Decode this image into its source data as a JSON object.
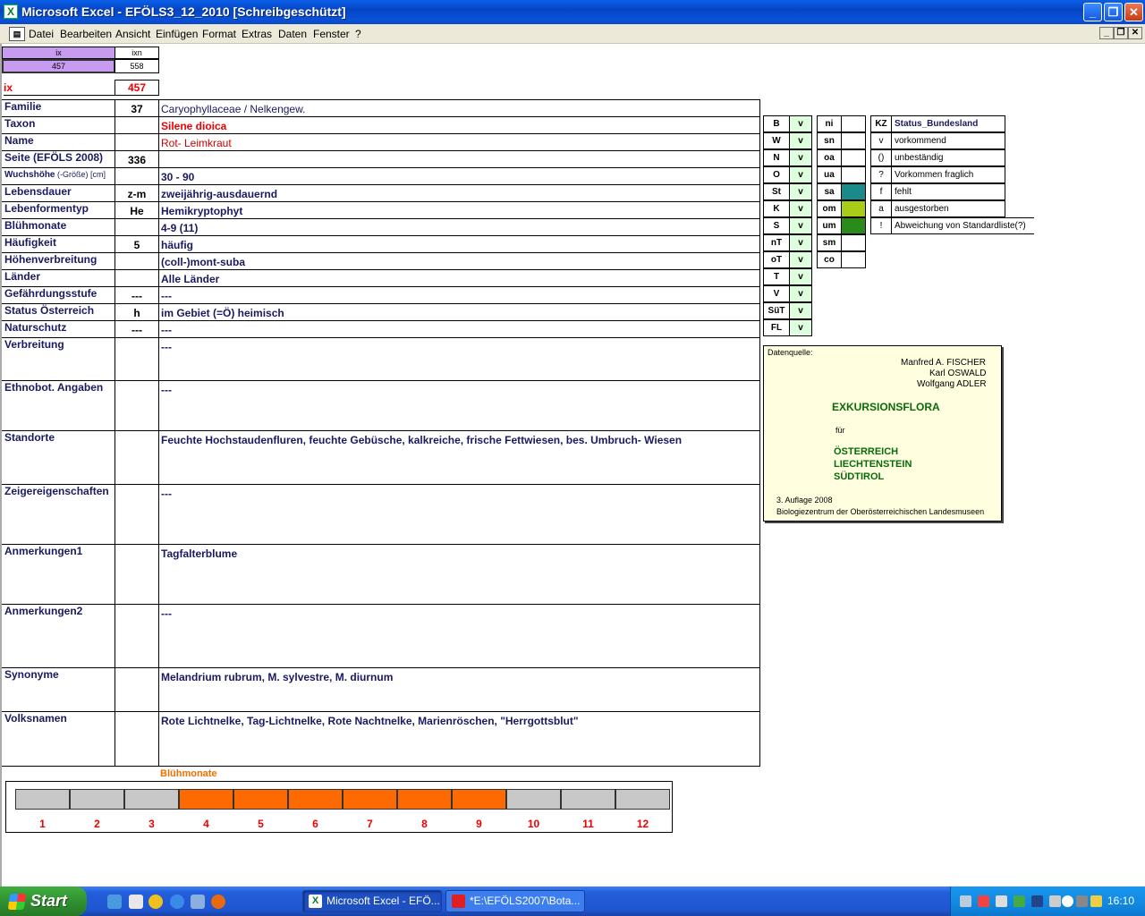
{
  "window": {
    "title": "Microsoft Excel - EFÖLS3_12_2010  [Schreibgeschützt]"
  },
  "menu": [
    "Datei",
    "Bearbeiten",
    "Ansicht",
    "Einfügen",
    "Format",
    "Extras",
    "Daten",
    "Fenster",
    "?"
  ],
  "top": {
    "ix_header": "ix",
    "ixn_header": "ixn",
    "ix_value": "457",
    "ixn_value": "558",
    "ix_label": "ix",
    "ix_big": "457"
  },
  "rows": [
    {
      "label": "Familie",
      "code": "37",
      "value": "Caryophyllaceae  /  Nelkengew."
    },
    {
      "label": "Taxon",
      "code": "",
      "value": "Silene dioica"
    },
    {
      "label": "Name",
      "code": "",
      "value": "Rot- Leimkraut"
    },
    {
      "label": "Seite (EFÖLS 2008)",
      "code": "336",
      "value": ""
    },
    {
      "label": "Wuchshöhe",
      "label_suffix": " (-Größe) [cm]",
      "code": "",
      "value": " 30 - 90"
    },
    {
      "label": "Lebensdauer",
      "code": "z-m",
      "value": "zweijährig-ausdauernd"
    },
    {
      "label": "Lebenformentyp",
      "code": "He",
      "value": "Hemikryptophyt"
    },
    {
      "label": "Blühmonate",
      "code": "",
      "value": " 4-9 (11)"
    },
    {
      "label": "Häufigkeit",
      "code": "5",
      "value": "häufig"
    },
    {
      "label": "Höhenverbreitung",
      "code": "",
      "value": "(coll-)mont-suba"
    },
    {
      "label": "Länder",
      "code": "",
      "value": "Alle Länder"
    },
    {
      "label": "Gefährdungsstufe",
      "code": "---",
      "value": "  ---"
    },
    {
      "label": "Status Österreich",
      "code": "h",
      "value": "im Gebiet (=Ö) heimisch"
    },
    {
      "label": "Naturschutz",
      "code": "---",
      "value": " ---"
    },
    {
      "label": "Verbreitung",
      "code": "",
      "value": " ---"
    },
    {
      "label": "Ethnobot. Angaben",
      "code": "",
      "value": "---"
    },
    {
      "label": "Standorte",
      "code": "",
      "value": "Feuchte Hochstaudenfluren, feuchte Gebüsche, kalkreiche, frische Fettwiesen, bes. Umbruch- Wiesen"
    },
    {
      "label": "Zeigereigenschaften",
      "code": "",
      "value": "---"
    },
    {
      "label": "Anmerkungen1",
      "code": "",
      "value": "Tagfalterblume"
    },
    {
      "label": "Anmerkungen2",
      "code": "",
      "value": "---"
    },
    {
      "label": "Synonyme",
      "code": "",
      "value": "Melandrium rubrum, M. sylvestre, M. diurnum"
    },
    {
      "label": "Volksnamen",
      "code": "",
      "value": "Rote Lichtnelke, Tag-Lichtnelke, Rote Nachtnelke, Marienröschen, \"Herrgottsblut\""
    }
  ],
  "states": {
    "codes": [
      "B",
      "W",
      "N",
      "O",
      "St",
      "K",
      "S",
      "nT",
      "oT",
      "T",
      "V",
      "SüT",
      "FL"
    ],
    "values": [
      "v",
      "v",
      "v",
      "v",
      "v",
      "v",
      "v",
      "v",
      "v",
      "v",
      "v",
      "v",
      "v"
    ]
  },
  "regions": [
    "ni",
    "sn",
    "oa",
    "ua",
    "sa",
    "om",
    "um",
    "sm",
    "co"
  ],
  "region_colors": {
    "sa": "#1a8a8a",
    "om": "#a8cc18",
    "um": "#2a8a1a"
  },
  "kz_legend": {
    "header_code": "KZ",
    "header_label": "Status_Bundesland",
    "items": [
      {
        "code": "v",
        "label": "vorkommend"
      },
      {
        "code": "()",
        "label": "unbeständig"
      },
      {
        "code": "?",
        "label": "Vorkommen fraglich"
      },
      {
        "code": "f",
        "label": "fehlt"
      },
      {
        "code": "a",
        "label": "ausgestorben"
      },
      {
        "code": "!",
        "label": "Abweichung von Standardliste(?)"
      }
    ]
  },
  "source": {
    "heading": "Datenquelle:",
    "authors": [
      "Manfred A. FISCHER",
      "Karl OSWALD",
      "Wolfgang ADLER"
    ],
    "title": "EXKURSIONSFLORA",
    "fuer": "für",
    "countries": [
      "ÖSTERREICH",
      "LIECHTENSTEIN",
      "SÜDTIROL"
    ],
    "edition": "3. Auflage 2008",
    "publisher": "Biologiezentrum der Oberösterreichischen Landesmuseen"
  },
  "bloom": {
    "title": "Blühmonate",
    "months": [
      "1",
      "2",
      "3",
      "4",
      "5",
      "6",
      "7",
      "8",
      "9",
      "10",
      "11",
      "12"
    ],
    "active": [
      false,
      false,
      false,
      true,
      true,
      true,
      true,
      true,
      true,
      false,
      false,
      false
    ],
    "colors": {
      "active": "#ff6a00",
      "inactive": "#c8c8c8"
    }
  },
  "taskbar": {
    "start": "Start",
    "tasks": [
      "Microsoft Excel - EFÖ...",
      "*E:\\EFÖLS2007\\Bota..."
    ],
    "clock": "16:10"
  }
}
